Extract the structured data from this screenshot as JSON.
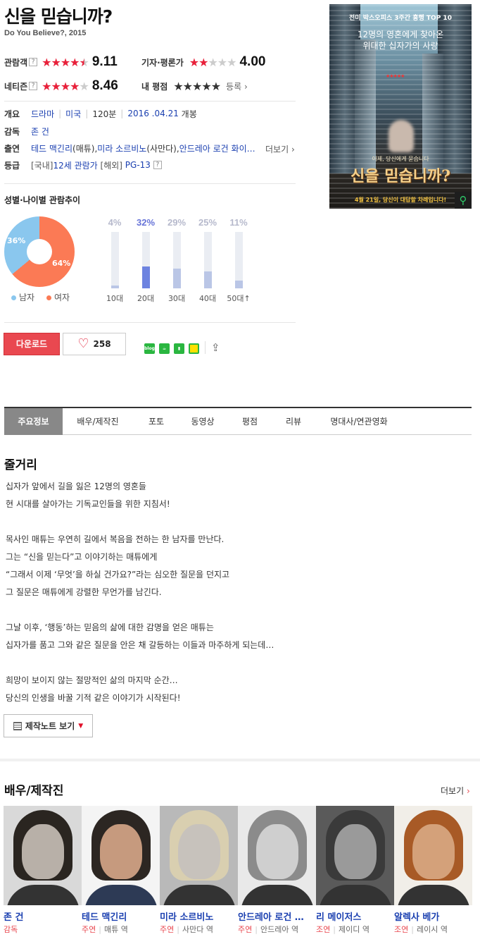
{
  "movie": {
    "title": "신을 믿습니까?",
    "subtitle": "Do You Believe?, 2015"
  },
  "ratings": {
    "audience": {
      "label": "관람객",
      "help": "?",
      "stars": 4.5,
      "score": "9.11"
    },
    "critic": {
      "label": "기자·평론가",
      "stars": 2,
      "score": "4.00"
    },
    "netizen": {
      "label": "네티즌",
      "help": "?",
      "stars": 4,
      "score": "8.46"
    },
    "mine": {
      "label": "내 평점",
      "stars": 0,
      "register": "등록"
    }
  },
  "info": {
    "overview_label": "개요",
    "genre": "드라마",
    "country": "미국",
    "runtime": "120분",
    "release_date": "2016 .04.21",
    "release_suffix": "개봉",
    "director_label": "감독",
    "director": "존 건",
    "cast_label": "출연",
    "cast_text": "테드 맥긴리",
    "cast_role1": "(매튜), ",
    "cast2": "미라 소르비노",
    "cast_role2": "(사만다), ",
    "cast3": "안드레아 로건 화이…",
    "more": "더보기",
    "rating_label": "등급",
    "grade_kr_prefix": "[국내] ",
    "grade_kr": "12세 관람가",
    "grade_intl_prefix": " [해외] ",
    "grade_intl": "PG-13",
    "grade_help": "?"
  },
  "demographics": {
    "title": "성별·나이별 관람추이",
    "male_pct": "36%",
    "female_pct": "64%",
    "male_label": "남자",
    "female_label": "여자",
    "ages": [
      {
        "pct": "4%",
        "value": 4,
        "label": "10대"
      },
      {
        "pct": "32%",
        "value": 32,
        "label": "20대",
        "highlight": true
      },
      {
        "pct": "29%",
        "value": 29,
        "label": "30대"
      },
      {
        "pct": "25%",
        "value": 25,
        "label": "40대"
      },
      {
        "pct": "11%",
        "value": 11,
        "label": "50대↑"
      }
    ]
  },
  "actions": {
    "download": "다운로드",
    "like_count": "258",
    "sns": [
      "blog",
      "cafe",
      "bookmark",
      "memo"
    ]
  },
  "poster": {
    "top_line1": "전미 박스오피스 3주간 흥행 TOP 10",
    "top_line2": "12명의 영혼에게 찾아온",
    "top_line3": "위대한 십자가의 사랑",
    "tag": "이제, 당신에게 묻습니다",
    "title": "신을 믿습니까?",
    "bottom": "4월 21일, 당신이 대답할 차례입니다!"
  },
  "tabs": [
    "주요정보",
    "배우/제작진",
    "포토",
    "동영상",
    "평점",
    "리뷰",
    "명대사/연관영화"
  ],
  "synopsis": {
    "title": "줄거리",
    "lines": [
      "십자가 앞에서 길을 잃은 12명의 영혼들",
      " 현 시대를 살아가는 기독교인들을 위한 지침서!",
      "",
      "목사인 매튜는 우연히 길에서 복음을 전하는 한 남자를 만난다.",
      "그는 “신을 믿는다”고 이야기하는 매튜에게",
      "“그래서 이제 ‘무엇’을 하실 건가요?”라는 심오한 질문을 던지고",
      "그 질문은 매튜에게 강렬한 무언가를 남긴다.",
      "",
      "그날 이후, ‘행동’하는 믿음의 삶에 대한 감명을 얻은 매튜는",
      "십자가를 품고 그와 같은 질문을 안은 채 갈등하는 이들과 마주하게 되는데…",
      "",
      "희망이 보이지 않는 절망적인 삶의 마지막 순간…",
      "당신의 인생을 바꿀 기적 같은 이야기가 시작된다!"
    ],
    "note_button": "제작노트 보기"
  },
  "cast": {
    "title": "배우/제작진",
    "more": "더보기",
    "people": [
      {
        "name": "존 건",
        "kind": "감독",
        "role": ""
      },
      {
        "name": "테드 맥긴리",
        "kind": "주연",
        "role": "매튜 역"
      },
      {
        "name": "미라 소르비노",
        "kind": "주연",
        "role": "사만다 역"
      },
      {
        "name": "안드레아 로건 …",
        "kind": "주연",
        "role": "안드레아 역"
      },
      {
        "name": "리 메이저스",
        "kind": "조연",
        "role": "제이디 역"
      },
      {
        "name": "알렉사 베가",
        "kind": "조연",
        "role": "레이시 역"
      }
    ]
  },
  "colors": {
    "accent": "#e94850",
    "link": "#1a3fb0",
    "star": "#e8203a",
    "female": "#fb7a55",
    "male": "#8ac7ee",
    "age_highlight": "#6d83e0"
  }
}
